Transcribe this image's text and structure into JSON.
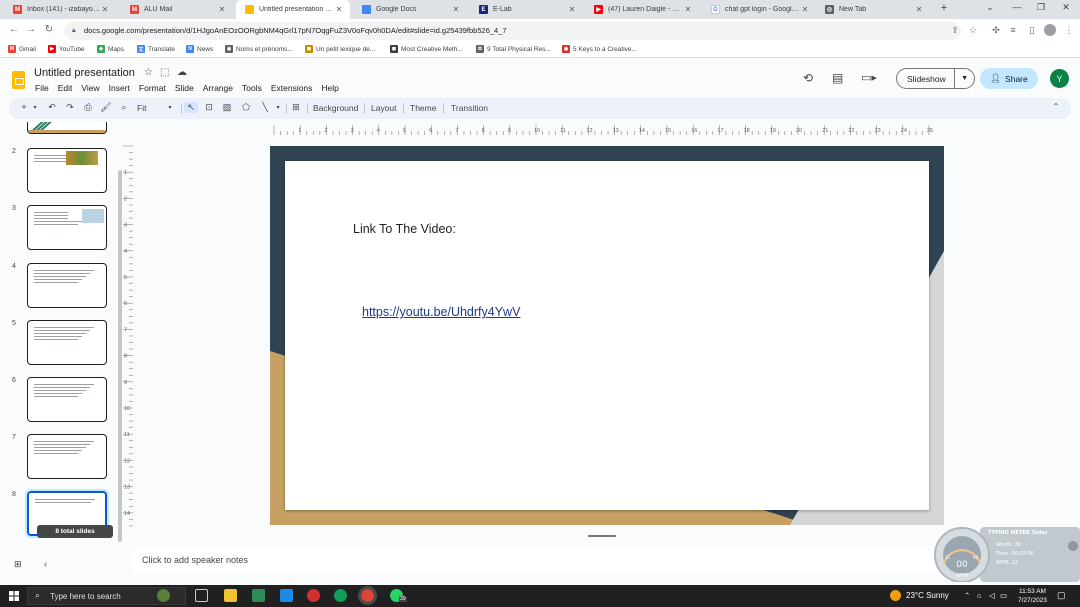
{
  "browser": {
    "tabs": [
      {
        "title": "Inbox (141) - izabayoyvanr...",
        "icon": "gmail-icon",
        "color": "#ea4335",
        "glyph": "M"
      },
      {
        "title": "ALU Mail",
        "icon": "gmail-icon",
        "color": "#ea4335",
        "glyph": "M"
      },
      {
        "title": "Untitled presentation - Go...",
        "icon": "slides-icon",
        "color": "#fbbc04",
        "glyph": "",
        "active": true
      },
      {
        "title": "Google Docs",
        "icon": "docs-icon",
        "color": "#4285f4",
        "glyph": ""
      },
      {
        "title": "E-Lab",
        "icon": "elab-icon",
        "color": "#1a237e",
        "glyph": "E"
      },
      {
        "title": "(47) Lauren Daigle - Yo...",
        "icon": "youtube-icon",
        "color": "#ff0000",
        "glyph": "▶"
      },
      {
        "title": "chat gpt login - Google S...",
        "icon": "google-icon",
        "color": "#ffffff",
        "glyph": "G"
      },
      {
        "title": "New Tab",
        "icon": "chrome-icon",
        "color": "#5f6368",
        "glyph": "◎"
      }
    ],
    "new_tab_label": "+",
    "window_controls": [
      "⌄",
      "—",
      "❐",
      "✕"
    ],
    "url": "docs.google.com/presentation/d/1HJgoAnEOzOORgbNM4qGrl17pN7OqgFuZ3V0oFqv0h0DA/edit#slide=id.g25439fbb526_4_7",
    "bookmarks": [
      {
        "label": "Gmail",
        "color": "#ea4335",
        "glyph": "M"
      },
      {
        "label": "YouTube",
        "color": "#ff0000",
        "glyph": "▶"
      },
      {
        "label": "Maps",
        "color": "#34a853",
        "glyph": "◆"
      },
      {
        "label": "Translate",
        "color": "#4285f4",
        "glyph": "文"
      },
      {
        "label": "News",
        "color": "#4285f4",
        "glyph": "N"
      },
      {
        "label": "Noms et prénoms...",
        "color": "#5f6368",
        "glyph": "◉"
      },
      {
        "label": "Un petit lexique de...",
        "color": "#c58a00",
        "glyph": "◼"
      },
      {
        "label": "Most Creative Meth...",
        "color": "#3c4043",
        "glyph": "◼"
      },
      {
        "label": "9 Total Physical Res...",
        "color": "#5f6368",
        "glyph": "✿"
      },
      {
        "label": "5 Keys to a Creative...",
        "color": "#d93025",
        "glyph": "◉"
      }
    ]
  },
  "slides_app": {
    "doc_title": "Untitled presentation",
    "menus": [
      "File",
      "Edit",
      "View",
      "Insert",
      "Format",
      "Slide",
      "Arrange",
      "Tools",
      "Extensions",
      "Help"
    ],
    "slideshow_label": "Slideshow",
    "share_label": "Share",
    "avatar_letter": "Y",
    "toolbar": {
      "zoom_label": "Fit",
      "background_label": "Background",
      "layout_label": "Layout",
      "theme_label": "Theme",
      "transition_label": "Transition"
    },
    "filmstrip": {
      "slide_numbers": [
        "2",
        "3",
        "4",
        "5",
        "6",
        "7",
        "8"
      ],
      "total_badge": "8 total slides"
    },
    "ruler_h_labels": [
      "1",
      "2",
      "3",
      "4",
      "5",
      "6",
      "7",
      "8",
      "9",
      "10",
      "11",
      "12",
      "13",
      "14",
      "15",
      "16",
      "17",
      "18",
      "19",
      "20",
      "21",
      "22",
      "23",
      "24",
      "25"
    ],
    "ruler_v_labels": [
      "1",
      "2",
      "3",
      "4",
      "5",
      "6",
      "7",
      "8",
      "9",
      "10",
      "11",
      "12",
      "13",
      "14"
    ],
    "slide": {
      "heading": "Link To The Video:",
      "link": "https://youtu.be/Uhdrfy4YwV",
      "colors": {
        "frame": "#2f4351",
        "gold": "#c6a163",
        "grey": "#d5d6d8"
      }
    },
    "speaker_notes_placeholder": "Click to add speaker notes"
  },
  "typing_widget": {
    "title": "TYPING METER Today",
    "words": "Words: 30",
    "time": "Time: 00:02:56",
    "wpm": "WPM: 12",
    "gauge_value": "00",
    "gauge_unit": "WPM",
    "tick_low": "15",
    "tick_high": "60"
  },
  "taskbar": {
    "search_placeholder": "Type here to search",
    "weather": "23°C  Sunny",
    "time": "11:53 AM",
    "date": "7/27/2023",
    "whatsapp_badge": "39"
  }
}
